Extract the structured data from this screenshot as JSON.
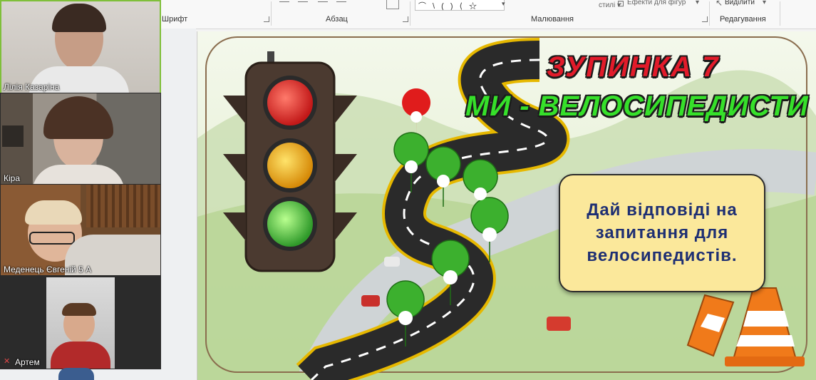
{
  "ribbon": {
    "font_group": "Шрифт",
    "paragraph_group": "Абзац",
    "drawing_group": "Малювання",
    "editing_group": "Редагування",
    "styles_label": "стилі",
    "effects_label": "Ефекти для фігур",
    "select_label": "Виділити"
  },
  "participants": [
    {
      "name": "Лілія Казаріна",
      "muted": false,
      "active": true
    },
    {
      "name": "Кіра",
      "muted": false,
      "active": false
    },
    {
      "name": "Меденець Євгеній 5 А",
      "muted": false,
      "active": false
    },
    {
      "name": "Артем",
      "muted": true,
      "active": false
    }
  ],
  "slide": {
    "title_line1": "ЗУПИНКА 7",
    "title_line2": "МИ - ВЕЛОСИПЕДИСТИ",
    "question_text": "Дай відповіді на запитання для велосипедистів.",
    "colors": {
      "title_red": "#e21b2a",
      "title_green": "#36e02a",
      "box_fill": "#fbe89b",
      "box_text": "#1e2f73"
    }
  }
}
